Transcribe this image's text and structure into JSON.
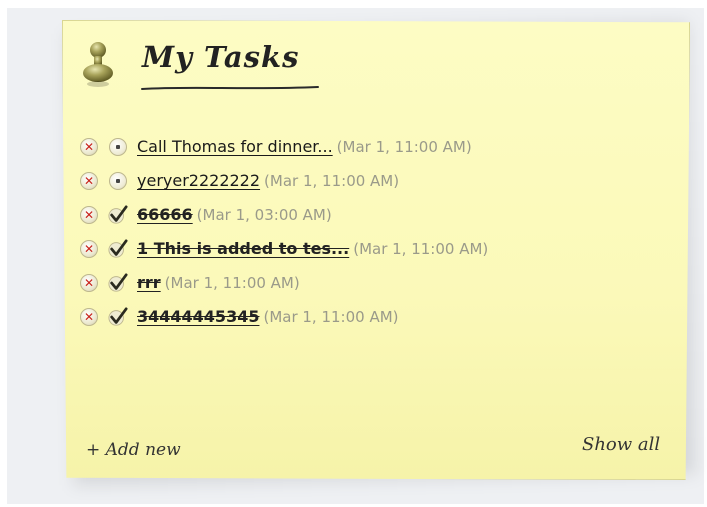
{
  "widget": {
    "title": "My Tasks",
    "add_new_label": "+ Add new",
    "show_all_label": "Show all",
    "delete_icon": "close-icon",
    "pending_icon": "radio-icon",
    "done_icon": "checkmark-icon",
    "colors": {
      "note_bg": "#fbf9b9",
      "delete_x": "#c8231c",
      "time_text": "#9a9a8a"
    }
  },
  "tasks": [
    {
      "text": "Call Thomas for dinner...",
      "time": "(Mar 1, 11:00 AM)",
      "done": false
    },
    {
      "text": "yeryer2222222",
      "time": "(Mar 1, 11:00 AM)",
      "done": false
    },
    {
      "text": "66666",
      "time": "(Mar 1, 03:00 AM)",
      "done": true
    },
    {
      "text": "1 This is added to tes...",
      "time": "(Mar 1, 11:00 AM)",
      "done": true
    },
    {
      "text": "rrr",
      "time": "(Mar 1, 11:00 AM)",
      "done": true
    },
    {
      "text": "34444445345",
      "time": "(Mar 1, 11:00 AM)",
      "done": true
    }
  ]
}
